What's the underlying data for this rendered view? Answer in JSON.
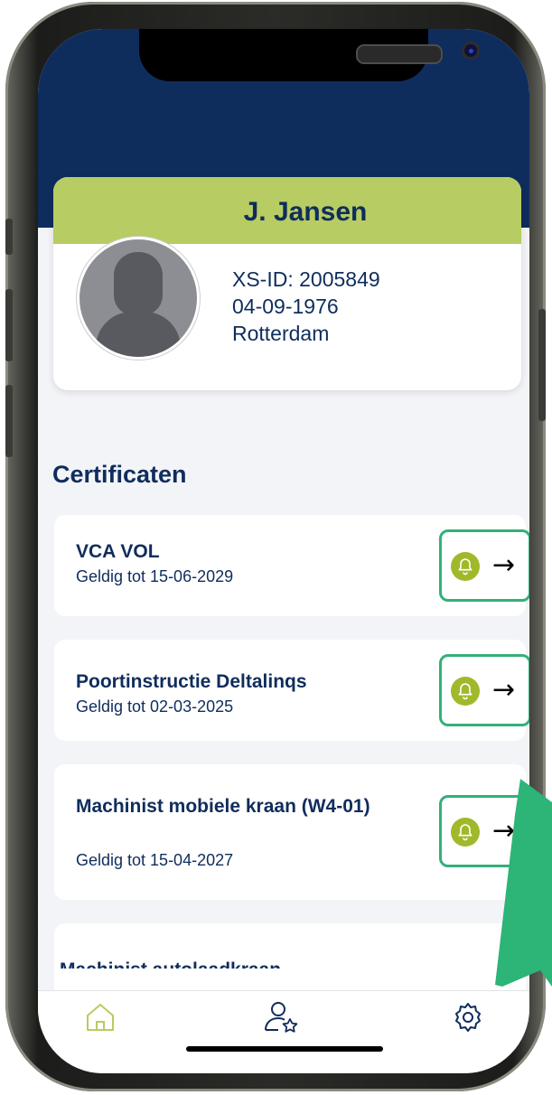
{
  "profile": {
    "name": "J. Jansen",
    "xs_id": "XS-ID: 2005849",
    "birthdate": "04-09-1976",
    "city": "Rotterdam"
  },
  "section_title": "Certificaten",
  "certificates": [
    {
      "name": "VCA VOL",
      "valid": "Geldig tot 15-06-2029"
    },
    {
      "name": "Poortinstructie Deltalinqs",
      "valid": "Geldig tot 02-03-2025"
    },
    {
      "name": "Machinist mobiele kraan (W4-01)",
      "valid": "Geldig tot 15-04-2027"
    },
    {
      "name": "Machinist autolaadkraan",
      "valid": ""
    }
  ],
  "icons": {
    "action_bell": "bell-icon",
    "action_arrow": "→",
    "nav": [
      "home-icon",
      "profile-star-icon",
      "gear-icon"
    ]
  },
  "colors": {
    "header_navy": "#0f2d5c",
    "accent_green": "#b7cc62",
    "highlight_green": "#33b07a",
    "bell_green": "#a0b92b"
  }
}
